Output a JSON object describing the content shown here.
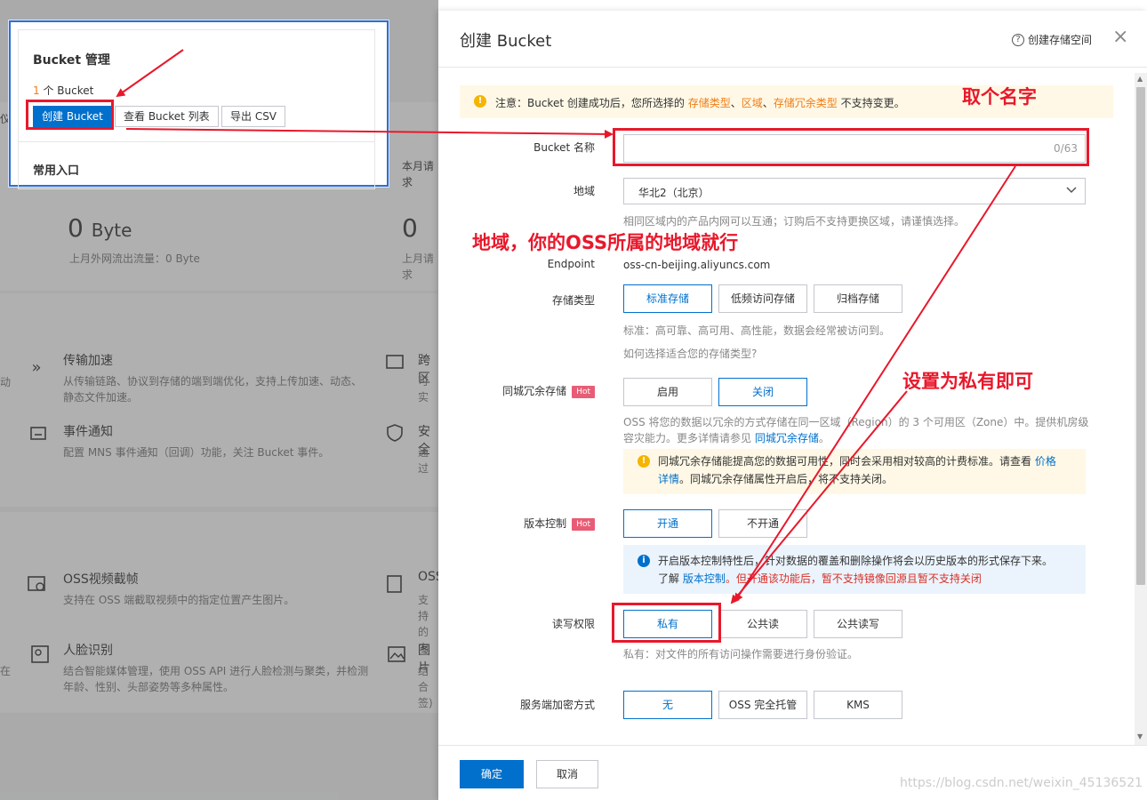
{
  "background": {
    "bucket_card": {
      "title": "Bucket 管理",
      "count_num": "1",
      "count_suffix": " 个 Bucket",
      "create_button": "创建 Bucket",
      "list_button": "查看 Bucket 列表",
      "export_button": "导出 CSV",
      "common_entry": "常用入口"
    },
    "left_cut": "仪",
    "month_request": "本月请求",
    "stat_bytes": "0",
    "stat_unit": "Byte",
    "stat_label": "上月外网流出流量：0 Byte",
    "stat_right_num": "0",
    "stat_right_label": "上月请求",
    "features": [
      {
        "icon": "chevrons-right-icon",
        "title": "传输加速",
        "desc": "从传输链路、协议到存储的端到端优化，支持上传加速、动态、静态文件加速。"
      },
      {
        "icon": "bell-icon",
        "title": "事件通知",
        "desc": "配置 MNS 事件通知（回调）功能，关注 Bucket 事件。"
      },
      {
        "icon": "video-icon",
        "title": "OSS视频截帧",
        "desc": "支持在 OSS 端截取视频中的指定位置产生图片。"
      },
      {
        "icon": "face-icon",
        "title": "人脸识别",
        "desc": "结合智能媒体管理，使用 OSS API 进行人脸检测与聚类，并检测年龄、性别、头部姿势等多种属性。"
      }
    ],
    "features_right": [
      {
        "title": "跨区",
        "desc": "可实"
      },
      {
        "title": "安全",
        "desc": "通过"
      },
      {
        "title": "OSS",
        "desc": "支持的内"
      },
      {
        "title": "图片",
        "desc": "结合签)"
      }
    ],
    "left_edge": {
      "a": "动",
      "b": "在"
    }
  },
  "drawer": {
    "title": "创建 Bucket",
    "help_link": "创建存储空间",
    "close": "×",
    "notice": {
      "prefix": "注意：Bucket 创建成功后，您所选择的 ",
      "k1": "存储类型",
      "sep1": "、",
      "k2": "区域",
      "sep2": "、",
      "k3": "存储冗余类型",
      "suffix": " 不支持变更。"
    },
    "bucket_name": {
      "label": "Bucket 名称",
      "value": "",
      "counter": "0/63"
    },
    "region": {
      "label": "地域",
      "value": "华北2（北京）",
      "hint": "相同区域内的产品内网可以互通；订购后不支持更换区域，请谨慎选择。"
    },
    "endpoint": {
      "label": "Endpoint",
      "value": "oss-cn-beijing.aliyuncs.com"
    },
    "storage_class": {
      "label": "存储类型",
      "options": [
        "标准存储",
        "低频访问存储",
        "归档存储"
      ],
      "hint": "标准：高可靠、高可用、高性能，数据会经常被访问到。",
      "link": "如何选择适合您的存储类型?"
    },
    "zone_redundancy": {
      "label": "同城冗余存储",
      "hot": "Hot",
      "options": [
        "启用",
        "关闭"
      ],
      "desc1": "OSS 将您的数据以冗余的方式存储在同一区域（Region）的 3 个可用区（Zone）中。提供机房级",
      "desc2_prefix": "容灾能力。更多详情请参见 ",
      "desc2_link": "同城冗余存储",
      "desc2_suffix": "。",
      "warn1_prefix": "同城冗余存储能提高您的数据可用性，同时会采用相对较高的计费标准。请查看 ",
      "warn1_link": "价格",
      "warn2_link": "详情",
      "warn2_suffix": "。同城冗余存储属性开启后，将不支持关闭。"
    },
    "versioning": {
      "label": "版本控制",
      "hot": "Hot",
      "options": [
        "开通",
        "不开通"
      ],
      "info1": "开启版本控制特性后，针对数据的覆盖和删除操作将会以历史版本的形式保存下来。",
      "info2_prefix": "了解 ",
      "info2_link": "版本控制",
      "info2_red": "。但开通该功能后，暂不支持镜像回源且暂不支持关闭"
    },
    "acl": {
      "label": "读写权限",
      "options": [
        "私有",
        "公共读",
        "公共读写"
      ],
      "hint": "私有：对文件的所有访问操作需要进行身份验证。"
    },
    "encryption": {
      "label": "服务端加密方式",
      "options": [
        "无",
        "OSS 完全托管",
        "KMS"
      ]
    },
    "footer": {
      "ok": "确定",
      "cancel": "取消"
    }
  },
  "annotations": {
    "name_tip": "取个名字",
    "region_tip": "地域，你的OSS所属的地域就行",
    "acl_tip": "设置为私有即可"
  },
  "watermark": "https://blog.csdn.net/weixin_45136521",
  "colors": {
    "primary": "#0070cc",
    "annotation": "#e8182b",
    "hot": "#e85d75",
    "link_orange": "#f07d16"
  }
}
